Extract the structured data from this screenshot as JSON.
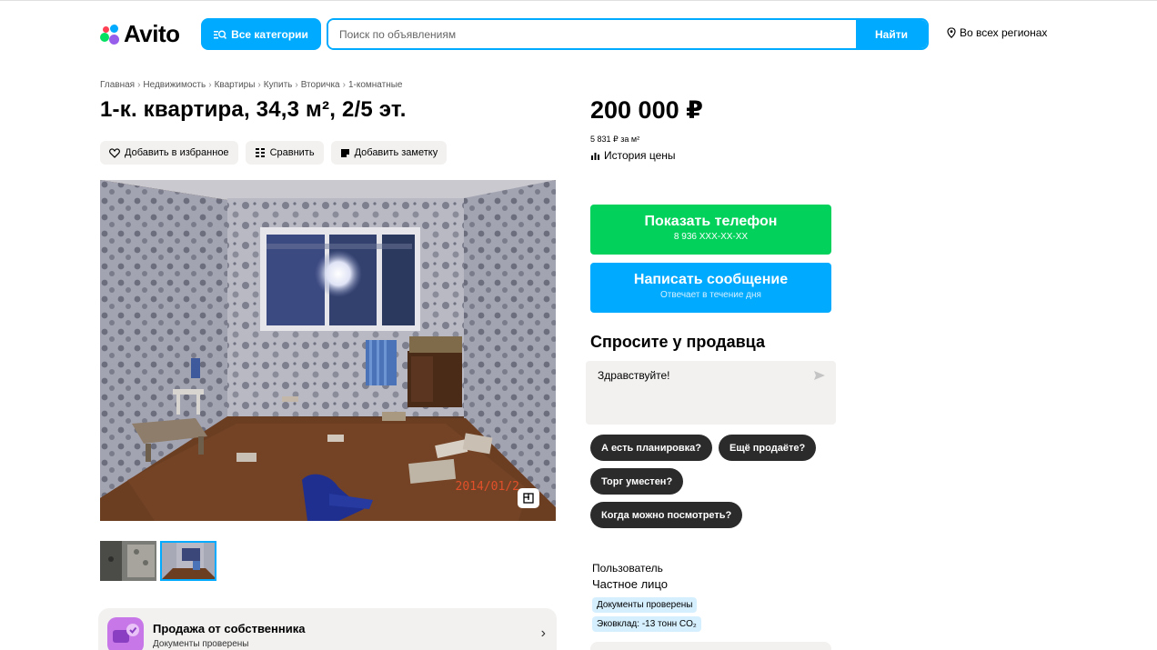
{
  "header": {
    "logo_text": "Avito",
    "categories_button": "Все категории",
    "search_placeholder": "Поиск по объявлениям",
    "search_button": "Найти",
    "region": "Во всех регионах"
  },
  "breadcrumb": [
    "Главная",
    "Недвижимость",
    "Квартиры",
    "Купить",
    "Вторичка",
    "1-комнатные"
  ],
  "listing": {
    "title": "1-к. квартира, 34,3 м², 2/5 эт.",
    "actions": {
      "favorite": "Добавить в избранное",
      "compare": "Сравнить",
      "note": "Добавить заметку"
    },
    "photo_date": "2014/01/2",
    "owner_card": {
      "title": "Продажа от собственника",
      "subtitle": "Документы проверены"
    }
  },
  "sidebar": {
    "price": "200 000 ₽",
    "price_per_m2": "5 831 ₽ за м²",
    "price_history": "История цены",
    "phone_button": {
      "label": "Показать телефон",
      "sub": "8 936 XXX-XX-XX"
    },
    "message_button": {
      "label": "Написать сообщение",
      "sub": "Отвечает в течение дня"
    },
    "ask_title": "Спросите у продавца",
    "ask_message": "Здравствуйте!",
    "quick_questions": [
      "А есть планировка?",
      "Ещё продаёте?",
      "Торг уместен?",
      "Когда можно посмотреть?"
    ],
    "seller": {
      "label": "Пользователь",
      "type": "Частное лицо",
      "badges": [
        "Документы проверены",
        "Эковклад: -13 тонн CO₂"
      ]
    }
  },
  "colors": {
    "accent_blue": "#00aaff",
    "phone_green": "#02d15c",
    "chip_dark": "#2b2b2b",
    "light_bg": "#f2f1f0",
    "badge_blue": "#d5efff"
  },
  "icons": [
    "location-pin-icon",
    "heart-icon",
    "compare-icon",
    "note-icon",
    "price-history-icon",
    "send-icon",
    "photo-plan-icon",
    "chevron-right-icon"
  ]
}
